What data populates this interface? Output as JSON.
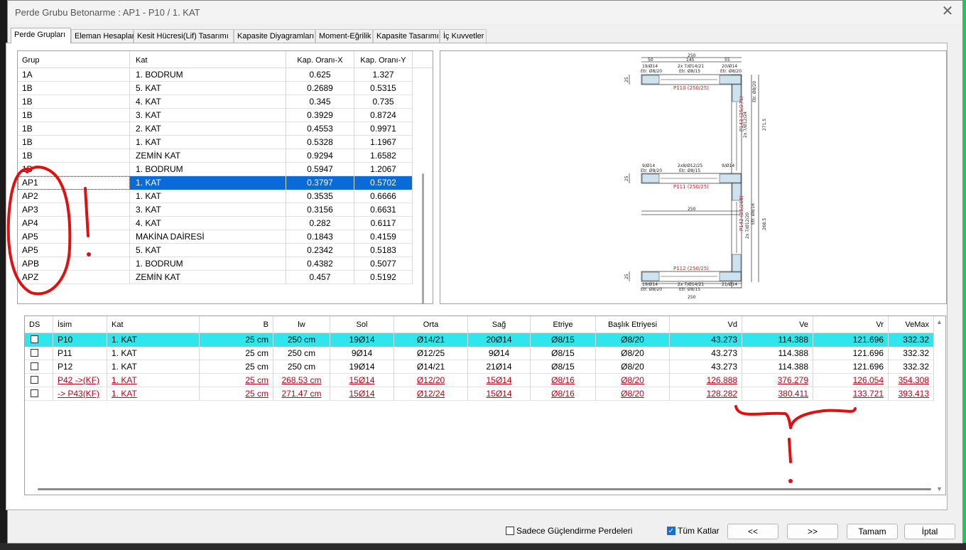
{
  "window": {
    "title": "Perde Grubu Betonarme  :  AP1 - P10 / 1. KAT",
    "close_glyph": "✕"
  },
  "tabs": [
    "Perde Grupları",
    "Eleman Hesapları",
    "Kesit Hücresi(Lif) Tasarımı",
    "Kapasite Diyagramları",
    "Moment-Eğrilik",
    "Kapasite Tasarımı",
    "İç Kuvvetler"
  ],
  "groups_table": {
    "columns": [
      "Grup",
      "Kat",
      "Kap. Oranı-X",
      "Kap. Oranı-Y"
    ],
    "selected_index": 8,
    "rows": [
      [
        "1A",
        "1. BODRUM",
        "0.625",
        "1.327"
      ],
      [
        "1B",
        "5. KAT",
        "0.2689",
        "0.5315"
      ],
      [
        "1B",
        "4. KAT",
        "0.345",
        "0.735"
      ],
      [
        "1B",
        "3. KAT",
        "0.3929",
        "0.8724"
      ],
      [
        "1B",
        "2. KAT",
        "0.4553",
        "0.9971"
      ],
      [
        "1B",
        "1. KAT",
        "0.5328",
        "1.1967"
      ],
      [
        "1B",
        "ZEMİN KAT",
        "0.9294",
        "1.6582"
      ],
      [
        "1B",
        "1. BODRUM",
        "0.5947",
        "1.2067"
      ],
      [
        "AP1",
        "1. KAT",
        "0.3797",
        "0.5702"
      ],
      [
        "AP2",
        "1. KAT",
        "0.3535",
        "0.6666"
      ],
      [
        "AP3",
        "3. KAT",
        "0.3156",
        "0.6631"
      ],
      [
        "AP4",
        "4. KAT",
        "0.282",
        "0.6117"
      ],
      [
        "AP5",
        "MAKİNA DAİRESİ",
        "0.1843",
        "0.4159"
      ],
      [
        "AP5",
        "5. KAT",
        "0.2342",
        "0.5183"
      ],
      [
        "APB",
        "1. BODRUM",
        "0.4382",
        "0.5077"
      ],
      [
        "APZ",
        "ZEMİN KAT",
        "0.457",
        "0.5192"
      ]
    ]
  },
  "drawing": {
    "labels": {
      "p110": "P110 (250/25)",
      "p111": "P111 (250/25)",
      "p112": "P112 (250/25)",
      "p143": "P143 (25/271)",
      "p142": "P142 (25/268)",
      "dim_250": "250",
      "dim_50": "50",
      "dim_145": "145",
      "dim_55": "55",
      "dim_25": "25",
      "dim_271": "271.5",
      "dim_268": "268.5",
      "r1": "19/Ø14",
      "r2": "2x 7/Ø14/21",
      "r3": "20/Ø14",
      "etr1": "Etr. Ø8/20",
      "etr2": "Etr. Ø8/15",
      "r4": "9/Ø14",
      "r5": "2x8/Ø12/25",
      "r6": "21/Ø14",
      "v1": "2x 7/Ø12/24",
      "v2": "2x 7/Ø12/20",
      "v3": "Etr. Ø8/16",
      "v4": "Etr. Ø8/20"
    }
  },
  "walls_table": {
    "columns": [
      "DS",
      "İsim",
      "Kat",
      "B",
      "lw",
      "Sol",
      "Orta",
      "Sağ",
      "Etriye",
      "Başlık Etriyesi",
      "Vd",
      "Ve",
      "Vr",
      "VeMax"
    ],
    "rows": [
      {
        "isim": "P10",
        "kat": "1. KAT",
        "b": "25 cm",
        "lw": "250 cm",
        "sol": "19Ø14",
        "orta": "Ø14/21",
        "sag": "20Ø14",
        "etriye": "Ø8/15",
        "baslik": "Ø8/20",
        "vd": "43.273",
        "ve": "114.388",
        "vr": "121.696",
        "vemax": "332.32",
        "style": "selected"
      },
      {
        "isim": "P11",
        "kat": "1. KAT",
        "b": "25 cm",
        "lw": "250 cm",
        "sol": "9Ø14",
        "orta": "Ø12/25",
        "sag": "9Ø14",
        "etriye": "Ø8/15",
        "baslik": "Ø8/20",
        "vd": "43.273",
        "ve": "114.388",
        "vr": "121.696",
        "vemax": "332.32",
        "style": "normal"
      },
      {
        "isim": "P12",
        "kat": "1. KAT",
        "b": "25 cm",
        "lw": "250 cm",
        "sol": "19Ø14",
        "orta": "Ø14/21",
        "sag": "21Ø14",
        "etriye": "Ø8/15",
        "baslik": "Ø8/20",
        "vd": "43.273",
        "ve": "114.388",
        "vr": "121.696",
        "vemax": "332.32",
        "style": "normal"
      },
      {
        "isim": "P42 ->(KF)",
        "kat": "1. KAT",
        "b": "25 cm",
        "lw": "268.53 cm",
        "sol": "15Ø14",
        "orta": "Ø12/20",
        "sag": "15Ø14",
        "etriye": "Ø8/16",
        "baslik": "Ø8/20",
        "vd": "126.888",
        "ve": "376.279",
        "vr": "126.054",
        "vemax": "354.308",
        "style": "red"
      },
      {
        "isim": "-> P43(KF)",
        "kat": "1. KAT",
        "b": "25 cm",
        "lw": "271.47 cm",
        "sol": "15Ø14",
        "orta": "Ø12/24",
        "sag": "15Ø14",
        "etriye": "Ø8/16",
        "baslik": "Ø8/20",
        "vd": "128.282",
        "ve": "380.411",
        "vr": "133.721",
        "vemax": "393.413",
        "style": "red"
      }
    ]
  },
  "footer": {
    "only_strengthening_label": "Sadece Güçlendirme Perdeleri",
    "only_strengthening_checked": false,
    "all_floors_label": "Tüm Katlar",
    "all_floors_checked": true,
    "prev_button": "<<",
    "next_button": ">>",
    "ok_button": "Tamam",
    "cancel_button": "İptal"
  },
  "colors": {
    "selection_blue": "#0a6ad8",
    "selection_cyan": "#2ee6ec",
    "warning_red": "#c0001a",
    "annotation_red": "#e01010"
  }
}
